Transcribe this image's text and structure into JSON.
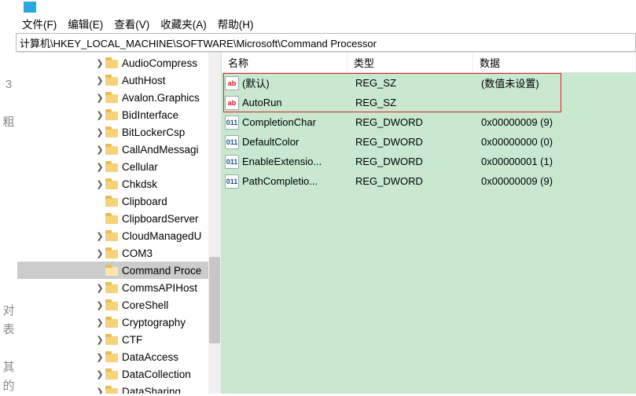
{
  "menu": {
    "file": "文件(F)",
    "edit": "编辑(E)",
    "view": "查看(V)",
    "fav": "收藏夹(A)",
    "help": "帮助(H)"
  },
  "address": "计算机\\HKEY_LOCAL_MACHINE\\SOFTWARE\\Microsoft\\Command Processor",
  "columns": {
    "name": "名称",
    "type": "类型",
    "data": "数据"
  },
  "tree": [
    {
      "label": "AudioCompress",
      "exp": true
    },
    {
      "label": "AuthHost",
      "exp": true
    },
    {
      "label": "Avalon.Graphics",
      "exp": true
    },
    {
      "label": "BidInterface",
      "exp": true
    },
    {
      "label": "BitLockerCsp",
      "exp": true
    },
    {
      "label": "CallAndMessagi",
      "exp": true
    },
    {
      "label": "Cellular",
      "exp": true
    },
    {
      "label": "Chkdsk",
      "exp": true
    },
    {
      "label": "Clipboard",
      "exp": false
    },
    {
      "label": "ClipboardServer",
      "exp": false
    },
    {
      "label": "CloudManagedU",
      "exp": true
    },
    {
      "label": "COM3",
      "exp": true
    },
    {
      "label": "Command Proce",
      "exp": false,
      "selected": true,
      "open": true
    },
    {
      "label": "CommsAPIHost",
      "exp": true
    },
    {
      "label": "CoreShell",
      "exp": true
    },
    {
      "label": "Cryptography",
      "exp": true
    },
    {
      "label": "CTF",
      "exp": true
    },
    {
      "label": "DataAccess",
      "exp": true
    },
    {
      "label": "DataCollection",
      "exp": true
    },
    {
      "label": "DataSharing",
      "exp": true
    }
  ],
  "values": [
    {
      "name": "(默认)",
      "type": "REG_SZ",
      "data": "(数值未设置)",
      "hl": true
    },
    {
      "name": "AutoRun",
      "type": "REG_SZ",
      "data": "",
      "hl": true
    },
    {
      "name": "CompletionChar",
      "type": "REG_DWORD",
      "data": "0x00000009 (9)"
    },
    {
      "name": "DefaultColor",
      "type": "REG_DWORD",
      "data": "0x00000000 (0)"
    },
    {
      "name": "EnableExtensio...",
      "type": "REG_DWORD",
      "data": "0x00000001 (1)"
    },
    {
      "name": "PathCompletio...",
      "type": "REG_DWORD",
      "data": "0x00000009 (9)"
    }
  ],
  "leftglyphs": "3\n\n粗\n\n\n\n\n\n\n\n\n\n对\n表\n\n其\n的"
}
